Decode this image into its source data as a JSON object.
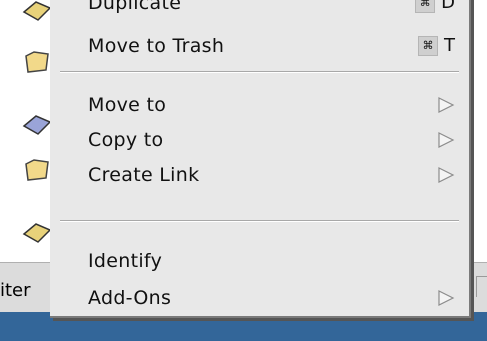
{
  "background": {
    "status_text": "iter",
    "desktop_color": "#336699"
  },
  "menu": {
    "items": [
      {
        "label": "Duplicate",
        "shortcut_key": "D"
      },
      {
        "label": "Move to Trash",
        "shortcut_key": "T",
        "shortcut_icon": "command-key-icon"
      },
      {
        "label": "Move to",
        "submenu": true
      },
      {
        "label": "Copy to",
        "submenu": true
      },
      {
        "label": "Create Link",
        "submenu": true
      },
      {
        "label": "Identify"
      },
      {
        "label": "Add-Ons",
        "submenu": true
      }
    ]
  }
}
